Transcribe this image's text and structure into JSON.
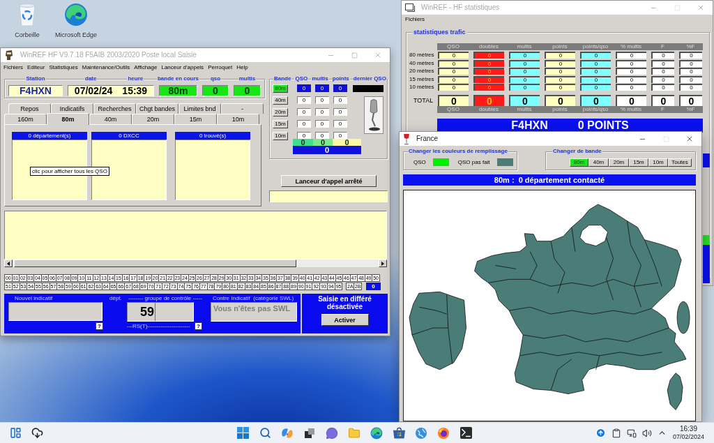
{
  "desktop": {
    "icons": [
      {
        "label": "Corbeille",
        "kind": "trash"
      },
      {
        "label": "Microsoft Edge",
        "kind": "browser"
      }
    ]
  },
  "main_window": {
    "title": "WinREF HF V9.7.18 F5AIB 2003/2020 Poste local Saisie",
    "active": false,
    "maximize_enabled": true,
    "menu": [
      "Fichiers",
      "Editeur",
      "Statistiques",
      "Maintenance/Outils",
      "Affichage",
      "Lanceur d'appels",
      "Perroquet",
      "Help"
    ],
    "header": {
      "station": {
        "label": "Station",
        "value": "F4HXN"
      },
      "date": {
        "label": "date",
        "value": "07/02/24"
      },
      "time": {
        "label": "heure",
        "value": "15:39"
      },
      "band": {
        "label": "bande en cours",
        "value": "80m"
      },
      "qso": {
        "label": "qso",
        "value": "0"
      },
      "multis": {
        "label": "multis",
        "value": "0"
      }
    },
    "band_panel": {
      "columns": [
        "Bande",
        "QSO",
        "multis",
        "points",
        "dernier QSO"
      ],
      "rows": [
        {
          "band": "80m",
          "selected": true,
          "qso": "0",
          "multis": "0",
          "points": "0"
        },
        {
          "band": "40m",
          "selected": false,
          "qso": "0",
          "multis": "0",
          "points": "0"
        },
        {
          "band": "20m",
          "selected": false,
          "qso": "0",
          "multis": "0",
          "points": "0"
        },
        {
          "band": "15m",
          "selected": false,
          "qso": "0",
          "multis": "0",
          "points": "0"
        },
        {
          "band": "10m",
          "selected": false,
          "qso": "0",
          "multis": "0",
          "points": "0"
        }
      ],
      "subtotals": [
        {
          "value": "0",
          "color": "#3ee08e"
        },
        {
          "value": "0",
          "color": "#7de88e"
        },
        {
          "value": "0",
          "color": "#fbf7a6"
        }
      ],
      "total": "0"
    },
    "tabs": {
      "upper": [
        {
          "label": "Repos",
          "selected": false
        },
        {
          "label": "Indicatifs",
          "selected": false
        },
        {
          "label": "Recherches",
          "selected": false
        },
        {
          "label": "Chgt bandes",
          "selected": false
        },
        {
          "label": "Limites bnd",
          "selected": false
        },
        {
          "label": "-",
          "selected": false
        }
      ],
      "lower": [
        {
          "label": "160m",
          "selected": false
        },
        {
          "label": "80m",
          "selected": true
        },
        {
          "label": "40m",
          "selected": false
        },
        {
          "label": "20m",
          "selected": false
        },
        {
          "label": "15m",
          "selected": false
        },
        {
          "label": "10m",
          "selected": false
        }
      ]
    },
    "lists": [
      {
        "title": "0 département(s)"
      },
      {
        "title": "0 DXCC"
      },
      {
        "title": "0 trouvé(s)"
      }
    ],
    "tooltip": "clic pour afficher tous les QSO",
    "caller_button": "Lanceur d'appel arrêté",
    "departments": {
      "row_1": [
        "00",
        "01",
        "02",
        "03",
        "04",
        "05",
        "06",
        "07",
        "08",
        "09",
        "10",
        "11",
        "12",
        "13",
        "14",
        "15",
        "16",
        "17",
        "18",
        "19",
        "20",
        "21",
        "22",
        "23",
        "24",
        "25",
        "26",
        "27",
        "28",
        "29",
        "30",
        "31",
        "32",
        "33",
        "34",
        "35",
        "36",
        "37",
        "38",
        "39",
        "40",
        "41",
        "42",
        "43",
        "44",
        "45",
        "46",
        "47",
        "48",
        "49",
        "50"
      ],
      "row_2": [
        "51",
        "52",
        "53",
        "54",
        "55",
        "56",
        "57",
        "58",
        "59",
        "60",
        "61",
        "62",
        "63",
        "64",
        "65",
        "66",
        "67",
        "68",
        "69",
        "70",
        "71",
        "72",
        "73",
        "74",
        "75",
        "76",
        "77",
        "78",
        "79",
        "80",
        "81",
        "82",
        "83",
        "84",
        "85",
        "86",
        "87",
        "88",
        "89",
        "90",
        "91",
        "92",
        "93",
        "94",
        "95"
      ],
      "corsica": [
        "2A",
        "2B"
      ],
      "count": "0"
    },
    "entry": {
      "new_call": {
        "label": "Nouvel indicatif",
        "help": "?"
      },
      "dept": {
        "label": "dépt."
      },
      "control_group": {
        "label": "-------- groupe de contrôle -----",
        "value": "59",
        "footer": "---RS(T)-----------------------",
        "help": "?"
      },
      "counter_call": {
        "label": "Contre Indicatif  (catégorie SWL)",
        "value": "Vous n'êtes pas SWL",
        "disabled": true
      }
    },
    "deferred": {
      "lines": [
        "Saisie en différé",
        "désactivée"
      ],
      "button": "Activer"
    }
  },
  "stats_window": {
    "title": "WinREF - HF statistiques",
    "active": false,
    "maximize_enabled": false,
    "menu": [
      "Fichiers"
    ],
    "group_title": "statistiques trafic",
    "columns": [
      {
        "label": "QSO",
        "color": "#ffffc0",
        "kind": "normal"
      },
      {
        "label": "doubles",
        "color": "#ff1a1a",
        "kind": "alert"
      },
      {
        "label": "multis",
        "color": "#80ffff",
        "kind": "normal"
      },
      {
        "label": "points",
        "color": "#ffffc0",
        "kind": "normal"
      },
      {
        "label": "points/qso",
        "color": "#80ffff",
        "kind": "normal"
      },
      {
        "label": "% multis",
        "color": "#ffffff",
        "kind": "normal"
      },
      {
        "label": "F",
        "color": "#ffffff",
        "kind": "normal"
      },
      {
        "label": "%F",
        "color": "#ffffff",
        "kind": "normal"
      }
    ],
    "rows": [
      {
        "label": "80 mètres",
        "values": [
          "0",
          "0",
          "0",
          "0",
          "0",
          "0",
          "0",
          "0"
        ]
      },
      {
        "label": "40 mètres",
        "values": [
          "0",
          "0",
          "0",
          "0",
          "0",
          "0",
          "0",
          "0"
        ]
      },
      {
        "label": "20 mètres",
        "values": [
          "0",
          "0",
          "0",
          "0",
          "0",
          "0",
          "0",
          "0"
        ]
      },
      {
        "label": "15 mètres",
        "values": [
          "0",
          "0",
          "0",
          "0",
          "0",
          "0",
          "0",
          "0"
        ]
      },
      {
        "label": "10 mètres",
        "values": [
          "0",
          "0",
          "0",
          "0",
          "0",
          "0",
          "0",
          "0"
        ]
      }
    ],
    "total": {
      "label": "TOTAL",
      "values": [
        "0",
        "0",
        "0",
        "0",
        "0",
        "0",
        "0",
        "0"
      ]
    },
    "footer_columns": [
      "QSO",
      "doubles",
      "multis",
      "points",
      "points/qso",
      "% multis",
      "F",
      "%F"
    ],
    "banner": {
      "callsign": "F4HXN",
      "points": "0 POINTS"
    }
  },
  "france_window": {
    "title": "France",
    "active": true,
    "maximize_enabled": false,
    "fill_colors": {
      "title": "Changer les couleurs de remplissage",
      "items": [
        {
          "label": "QSO",
          "color": "#00f000"
        },
        {
          "label": "QSO pas fait",
          "color": "#4a7c78"
        }
      ]
    },
    "band_selector": {
      "title": "Changer de bande",
      "bands": [
        {
          "label": "80m",
          "selected": true
        },
        {
          "label": "40m",
          "selected": false
        },
        {
          "label": "20m",
          "selected": false
        },
        {
          "label": "15m",
          "selected": false
        },
        {
          "label": "10m",
          "selected": false
        },
        {
          "label": "Toutes",
          "selected": false
        }
      ]
    },
    "banner": "80m :  0 département contacté"
  },
  "taskbar": {
    "time": "16:39",
    "date": "07/02/2024"
  }
}
